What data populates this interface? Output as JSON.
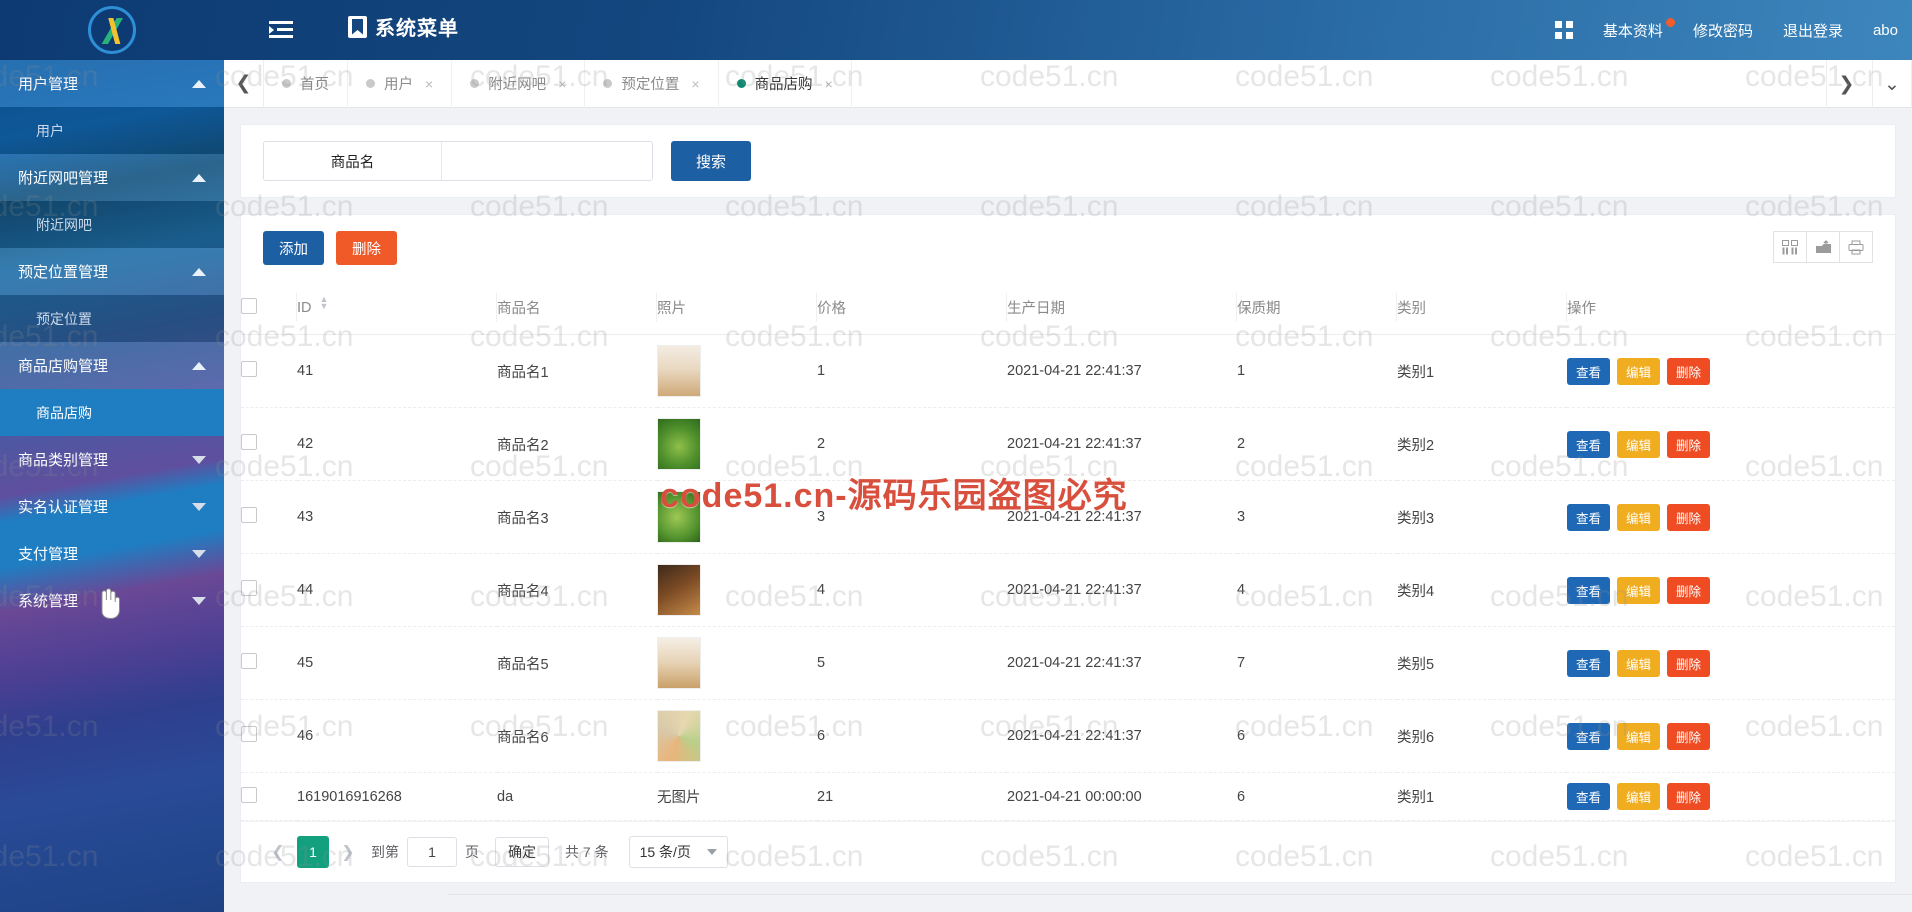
{
  "header": {
    "logo_alt": "logo",
    "menu_toggle_icon": "menu-collapse-icon",
    "title": "系统菜单",
    "fullscreen_icon": "fullscreen-icon",
    "links": [
      {
        "label": "基本资料",
        "badge": true
      },
      {
        "label": "修改密码",
        "badge": false
      },
      {
        "label": "退出登录",
        "badge": false
      },
      {
        "label": "abo",
        "badge": false
      }
    ]
  },
  "sidebar": {
    "groups": [
      {
        "label": "用户管理",
        "expanded": true,
        "highlight": true,
        "children": [
          {
            "label": "用户",
            "active": false
          }
        ]
      },
      {
        "label": "附近网吧管理",
        "expanded": true,
        "highlight": true,
        "children": [
          {
            "label": "附近网吧",
            "active": false
          }
        ]
      },
      {
        "label": "预定位置管理",
        "expanded": true,
        "highlight": true,
        "children": [
          {
            "label": "预定位置",
            "active": false
          }
        ]
      },
      {
        "label": "商品店购管理",
        "expanded": true,
        "highlight": true,
        "children": [
          {
            "label": "商品店购",
            "active": true
          }
        ]
      },
      {
        "label": "商品类别管理",
        "expanded": false,
        "highlight": false,
        "children": []
      },
      {
        "label": "实名认证管理",
        "expanded": false,
        "highlight": false,
        "children": []
      },
      {
        "label": "支付管理",
        "expanded": false,
        "highlight": false,
        "children": []
      },
      {
        "label": "系统管理",
        "expanded": false,
        "highlight": false,
        "children": []
      }
    ]
  },
  "tabs": {
    "prev_icon": "chevron-left-icon",
    "next_icon": "chevron-right-icon",
    "dropdown_icon": "chevron-down-icon",
    "items": [
      {
        "label": "首页",
        "closable": false,
        "active": false
      },
      {
        "label": "用户",
        "closable": true,
        "active": false
      },
      {
        "label": "附近网吧",
        "closable": true,
        "active": false
      },
      {
        "label": "预定位置",
        "closable": true,
        "active": false
      },
      {
        "label": "商品店购",
        "closable": true,
        "active": true
      }
    ],
    "close_glyph": "×"
  },
  "search": {
    "field_label": "商品名",
    "input_value": "",
    "input_placeholder": "",
    "button_label": "搜索"
  },
  "toolbar": {
    "add_label": "添加",
    "delete_label": "删除",
    "icons": [
      {
        "name": "columns-icon",
        "glyph": "▥"
      },
      {
        "name": "export-icon",
        "glyph": "⎘"
      },
      {
        "name": "print-icon",
        "glyph": "⎙"
      }
    ]
  },
  "table": {
    "columns": [
      "ID",
      "商品名",
      "照片",
      "价格",
      "生产日期",
      "保质期",
      "类别",
      "操作"
    ],
    "rows": [
      {
        "id": "41",
        "name": "商品名1",
        "photo": "photo",
        "price": "1",
        "produced": "2021-04-21 22:41:37",
        "shelf": "1",
        "category": "类别1"
      },
      {
        "id": "42",
        "name": "商品名2",
        "photo": "photo",
        "price": "2",
        "produced": "2021-04-21 22:41:37",
        "shelf": "2",
        "category": "类别2"
      },
      {
        "id": "43",
        "name": "商品名3",
        "photo": "photo",
        "price": "3",
        "produced": "2021-04-21 22:41:37",
        "shelf": "3",
        "category": "类别3"
      },
      {
        "id": "44",
        "name": "商品名4",
        "photo": "photo",
        "price": "4",
        "produced": "2021-04-21 22:41:37",
        "shelf": "4",
        "category": "类别4"
      },
      {
        "id": "45",
        "name": "商品名5",
        "photo": "photo",
        "price": "5",
        "produced": "2021-04-21 22:41:37",
        "shelf": "7",
        "category": "类别5"
      },
      {
        "id": "46",
        "name": "商品名6",
        "photo": "photo",
        "price": "6",
        "produced": "2021-04-21 22:41:37",
        "shelf": "6",
        "category": "类别6"
      },
      {
        "id": "1619016916268",
        "name": "da",
        "photo": "无图片",
        "price": "21",
        "produced": "2021-04-21 00:00:00",
        "shelf": "6",
        "category": "类别1"
      }
    ],
    "actions": {
      "view": "查看",
      "edit": "编辑",
      "delete": "删除"
    }
  },
  "pagination": {
    "current_page": "1",
    "goto_prefix": "到第",
    "goto_value": "1",
    "goto_suffix": "页",
    "confirm_label": "确定",
    "total_label": "共 7 条",
    "page_size_label": "15 条/页"
  },
  "watermark": {
    "tile_text": "code51.cn",
    "center_text": "code51.cn-源码乐园盗图必究"
  },
  "colors": {
    "primary": "#1d5fa3",
    "danger": "#f05a28",
    "edit": "#f0ad20",
    "view": "#1f68b5",
    "pager_active": "#12a07f",
    "tab_active_dot": "#0b8a72"
  }
}
